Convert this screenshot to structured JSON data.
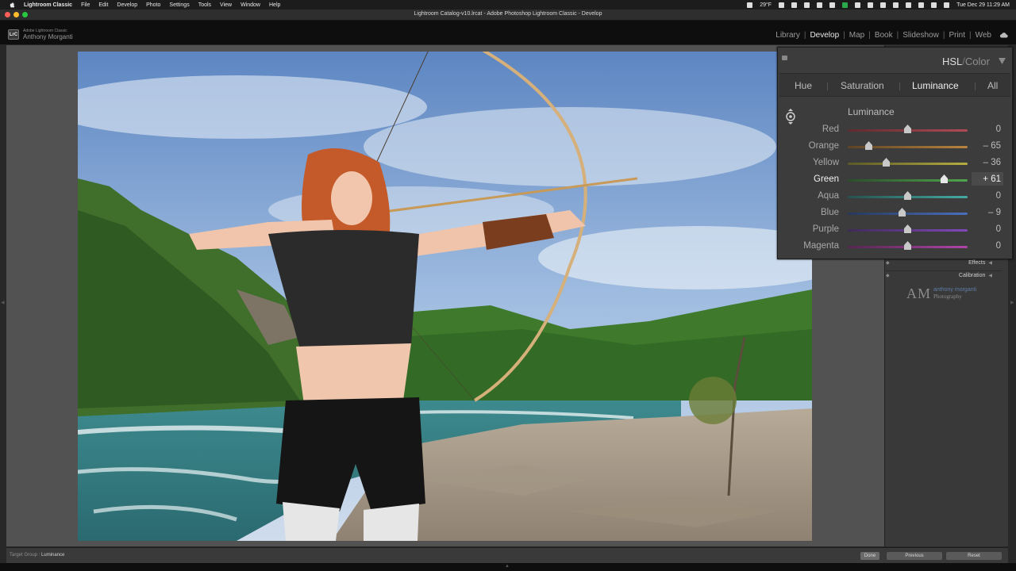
{
  "menubar": {
    "app_name": "Lightroom Classic",
    "items": [
      "File",
      "Edit",
      "Develop",
      "Photo",
      "Settings",
      "Tools",
      "View",
      "Window",
      "Help"
    ],
    "temperature": "29°F",
    "datetime": "Tue Dec 29  11:29 AM"
  },
  "window": {
    "title": "Lightroom Catalog-v10.lrcat - Adobe Photoshop Lightroom Classic - Develop"
  },
  "identity": {
    "product": "Adobe Lightroom Classic",
    "user": "Anthony Morganti",
    "logo_text": "LrC"
  },
  "modules": {
    "items": [
      "Library",
      "Develop",
      "Map",
      "Book",
      "Slideshow",
      "Print",
      "Web"
    ],
    "active": "Develop"
  },
  "hsl_panel": {
    "title_hsl": "HSL",
    "title_sep": "/",
    "title_color": "Color",
    "tabs": [
      "Hue",
      "Saturation",
      "Luminance",
      "All"
    ],
    "active_tab": "Luminance",
    "section_title": "Luminance",
    "sliders": [
      {
        "label": "Red",
        "value": 0,
        "display": "0",
        "colors": [
          "#5e2a2e",
          "#b04a56"
        ]
      },
      {
        "label": "Orange",
        "value": -65,
        "display": "– 65",
        "colors": [
          "#5e4326",
          "#b7843d"
        ]
      },
      {
        "label": "Yellow",
        "value": -36,
        "display": "– 36",
        "colors": [
          "#5b5a28",
          "#b5ad40"
        ]
      },
      {
        "label": "Green",
        "value": 61,
        "display": "+ 61",
        "colors": [
          "#2c4e2c",
          "#4fa54c"
        ]
      },
      {
        "label": "Aqua",
        "value": 0,
        "display": "0",
        "colors": [
          "#265250",
          "#45a9a2"
        ]
      },
      {
        "label": "Blue",
        "value": -9,
        "display": "– 9",
        "colors": [
          "#27385a",
          "#4a6fbe"
        ]
      },
      {
        "label": "Purple",
        "value": 0,
        "display": "0",
        "colors": [
          "#3f2a58",
          "#8048ba"
        ]
      },
      {
        "label": "Magenta",
        "value": 0,
        "display": "0",
        "colors": [
          "#552650",
          "#b045a8"
        ]
      }
    ],
    "highlighted": "Green"
  },
  "right_panels": {
    "effects": "Effects",
    "calibration": "Calibration"
  },
  "signature": {
    "initials": "AM",
    "name": "anthony morganti",
    "tagline": "Photography"
  },
  "toolbar": {
    "target_group_label": "Target Group :",
    "target_group_value": "Luminance",
    "done_label": "Done"
  },
  "bottom_buttons": {
    "previous": "Previous",
    "reset": "Reset"
  }
}
